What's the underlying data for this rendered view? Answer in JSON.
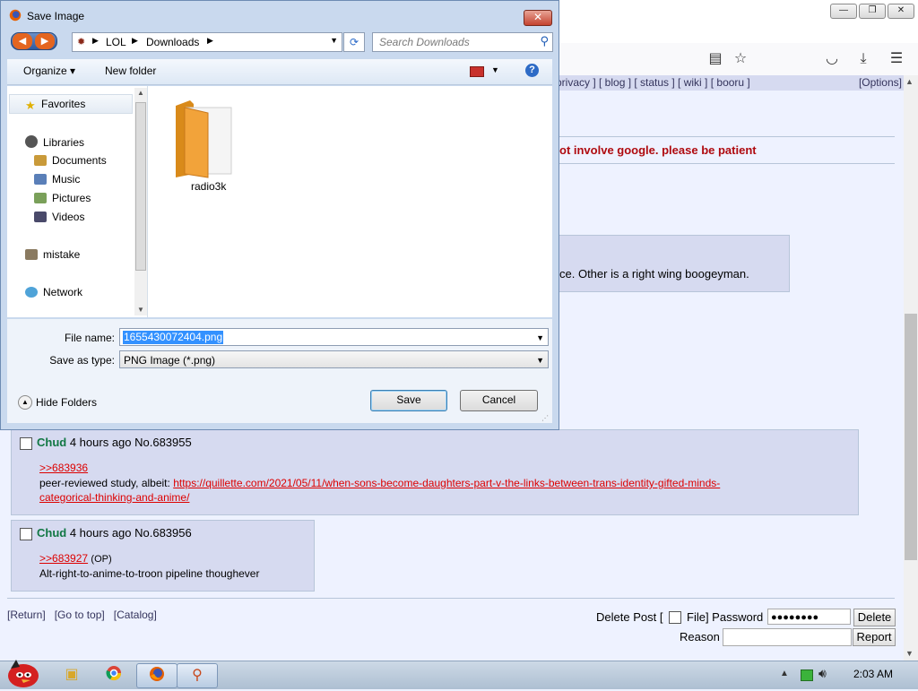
{
  "browser": {
    "navlinks": "privacy ] [ blog ] [ status ] [ wiki ] [ booru ]",
    "options": "[Options]",
    "notice": "ot involve google. please be patient",
    "reply_text": "ce. Other is a right wing boogeyman."
  },
  "posts": [
    {
      "name": "Chud",
      "meta": "4 hours ago No.683955",
      "quote": ">>683936",
      "line1_prefix": "peer-reviewed study, albeit: ",
      "link_part1": "https://quillette.com/2021/05/11/when-sons-become-daughters-part-v-the-links-between-trans-identity-gifted-minds-",
      "link_part2": "categorical-thinking-and-anime/"
    },
    {
      "name": "Chud",
      "meta": "4 hours ago No.683956",
      "quote": ">>683927",
      "op": "(OP)",
      "line1": "Alt-right-to-anime-to-troon pipeline thoughever"
    }
  ],
  "footer": {
    "return": "[Return]",
    "top": "[Go to top]",
    "catalog": "[Catalog]",
    "delete_label": "Delete Post [",
    "file_label": "File] Password",
    "password": "●●●●●●●●",
    "delete_btn": "Delete",
    "reason_label": "Reason",
    "report_btn": "Report"
  },
  "taskbar": {
    "clock": "2:03 AM"
  },
  "dialog": {
    "title": "Save Image",
    "close": "✕",
    "breadcrumb": [
      "LOL",
      "Downloads"
    ],
    "search_placeholder": "Search Downloads",
    "organize": "Organize ▾",
    "new_folder": "New folder",
    "nav": {
      "favorites": "Favorites",
      "libraries": "Libraries",
      "documents": "Documents",
      "music": "Music",
      "pictures": "Pictures",
      "videos": "Videos",
      "mistake": "mistake",
      "network": "Network"
    },
    "folder_name": "radio3k",
    "file_name_label": "File name:",
    "file_name_value": "1655430072404.png",
    "save_type_label": "Save as type:",
    "save_type_value": "PNG Image (*.png)",
    "hide_folders": "Hide Folders",
    "save_btn": "Save",
    "cancel_btn": "Cancel"
  },
  "colors": {
    "accent_red": "#af0a0f",
    "name_green": "#117743",
    "reply_bg": "#d6daf0",
    "page_bg": "#eef2ff"
  }
}
